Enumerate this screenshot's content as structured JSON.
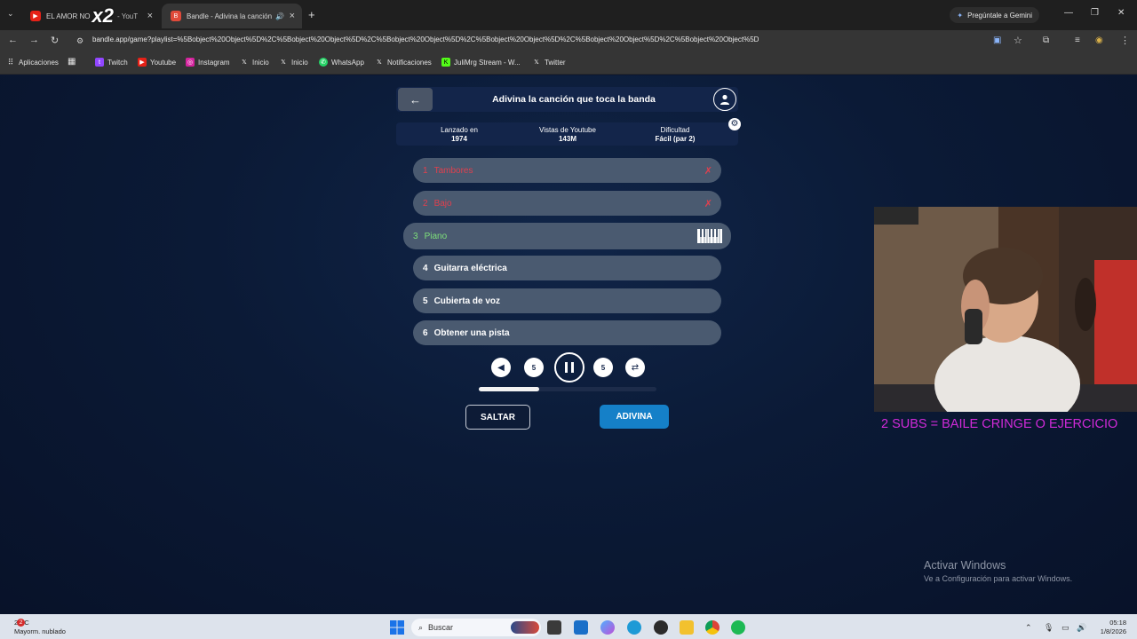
{
  "browser": {
    "tabs": [
      {
        "title": "EL AMOR NO",
        "suffix": "- YouT",
        "overlay": "x2"
      },
      {
        "title": "Bandle - Adivina la canción"
      }
    ],
    "new_tab": "+",
    "gemini_label": "Pregúntale a Gemini",
    "url": "bandle.app/game?playlist=%5Bobject%20Object%5D%2C%5Bobject%20Object%5D%2C%5Bobject%20Object%5D%2C%5Bobject%20Object%5D%2C%5Bobject%20Object%5D%2C%5Bobject%20Object%5D",
    "bookmarks": [
      "Aplicaciones",
      "Twitch",
      "Youtube",
      "Instagram",
      "Inicio",
      "Inicio",
      "WhatsApp",
      "Notificaciones",
      "JuliMrg Stream - W...",
      "Twitter"
    ]
  },
  "game": {
    "title": "Adivina la canción que toca la banda",
    "info": [
      {
        "label": "Lanzado en",
        "value": "1974"
      },
      {
        "label": "Vistas de Youtube",
        "value": "143M"
      },
      {
        "label": "Dificultad",
        "value": "Fácil (par 2)"
      }
    ],
    "clues": [
      {
        "n": "1",
        "label": "Tambores",
        "state": "failed"
      },
      {
        "n": "2",
        "label": "Bajo",
        "state": "failed"
      },
      {
        "n": "3",
        "label": "Piano",
        "state": "current"
      },
      {
        "n": "4",
        "label": "Guitarra eléctrica",
        "state": "locked"
      },
      {
        "n": "5",
        "label": "Cubierta de voz",
        "state": "locked"
      },
      {
        "n": "6",
        "label": "Obtener una pista",
        "state": "locked"
      }
    ],
    "controls": {
      "rewind_label": "5",
      "forward_label": "5"
    },
    "progress": 0.34,
    "skip_label": "SALTAR",
    "guess_label": "ADIVINA"
  },
  "overlay": {
    "banner": "2 SUBS = BAILE CRINGE O EJERCICIO"
  },
  "windows": {
    "activate_title": "Activar Windows",
    "activate_sub": "Ve a Configuración para activar Windows."
  },
  "taskbar": {
    "weather_temp": "29°C",
    "weather_desc": "Mayorm. nublado",
    "weather_badge": "2",
    "search_placeholder": "Buscar",
    "time": "05:18",
    "date": "1/8/2026"
  },
  "colors": {
    "accent_blue": "#1580c8",
    "failed_red": "#e0404e",
    "current_green": "#7ee07a",
    "banner_magenta": "#d02ad8"
  }
}
